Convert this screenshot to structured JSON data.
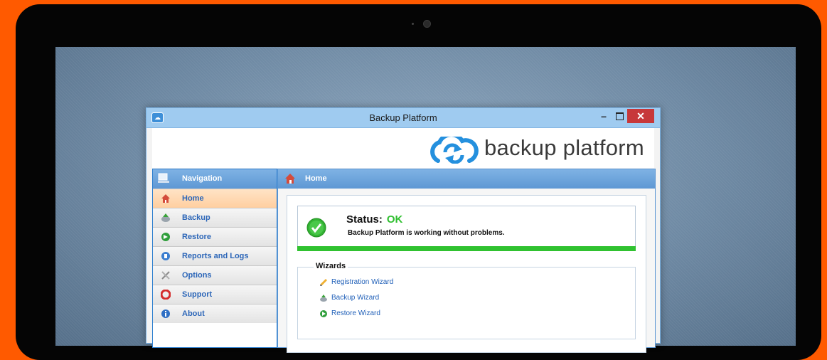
{
  "window": {
    "title": "Backup Platform",
    "minimize_label": "–",
    "close_label": "✕"
  },
  "banner": {
    "logo_text": "backup platform"
  },
  "sidebar": {
    "header": "Navigation",
    "items": [
      {
        "label": "Home",
        "icon": "home-icon",
        "active": true
      },
      {
        "label": "Backup",
        "icon": "backup-icon",
        "active": false
      },
      {
        "label": "Restore",
        "icon": "restore-icon",
        "active": false
      },
      {
        "label": "Reports and Logs",
        "icon": "reports-icon",
        "active": false
      },
      {
        "label": "Options",
        "icon": "options-icon",
        "active": false
      },
      {
        "label": "Support",
        "icon": "support-icon",
        "active": false
      },
      {
        "label": "About",
        "icon": "about-icon",
        "active": false
      }
    ]
  },
  "main": {
    "header": "Home",
    "status": {
      "label": "Status:",
      "value": "OK",
      "message": "Backup Platform is working without problems."
    },
    "wizards": {
      "title": "Wizards",
      "items": [
        {
          "label": "Registration Wizard",
          "icon": "registration-wizard-icon"
        },
        {
          "label": "Backup Wizard",
          "icon": "backup-wizard-icon"
        },
        {
          "label": "Restore Wizard",
          "icon": "restore-wizard-icon"
        }
      ]
    }
  },
  "colors": {
    "background": "#ff5a00",
    "status_ok": "#30c230",
    "accent": "#2f80d0"
  }
}
